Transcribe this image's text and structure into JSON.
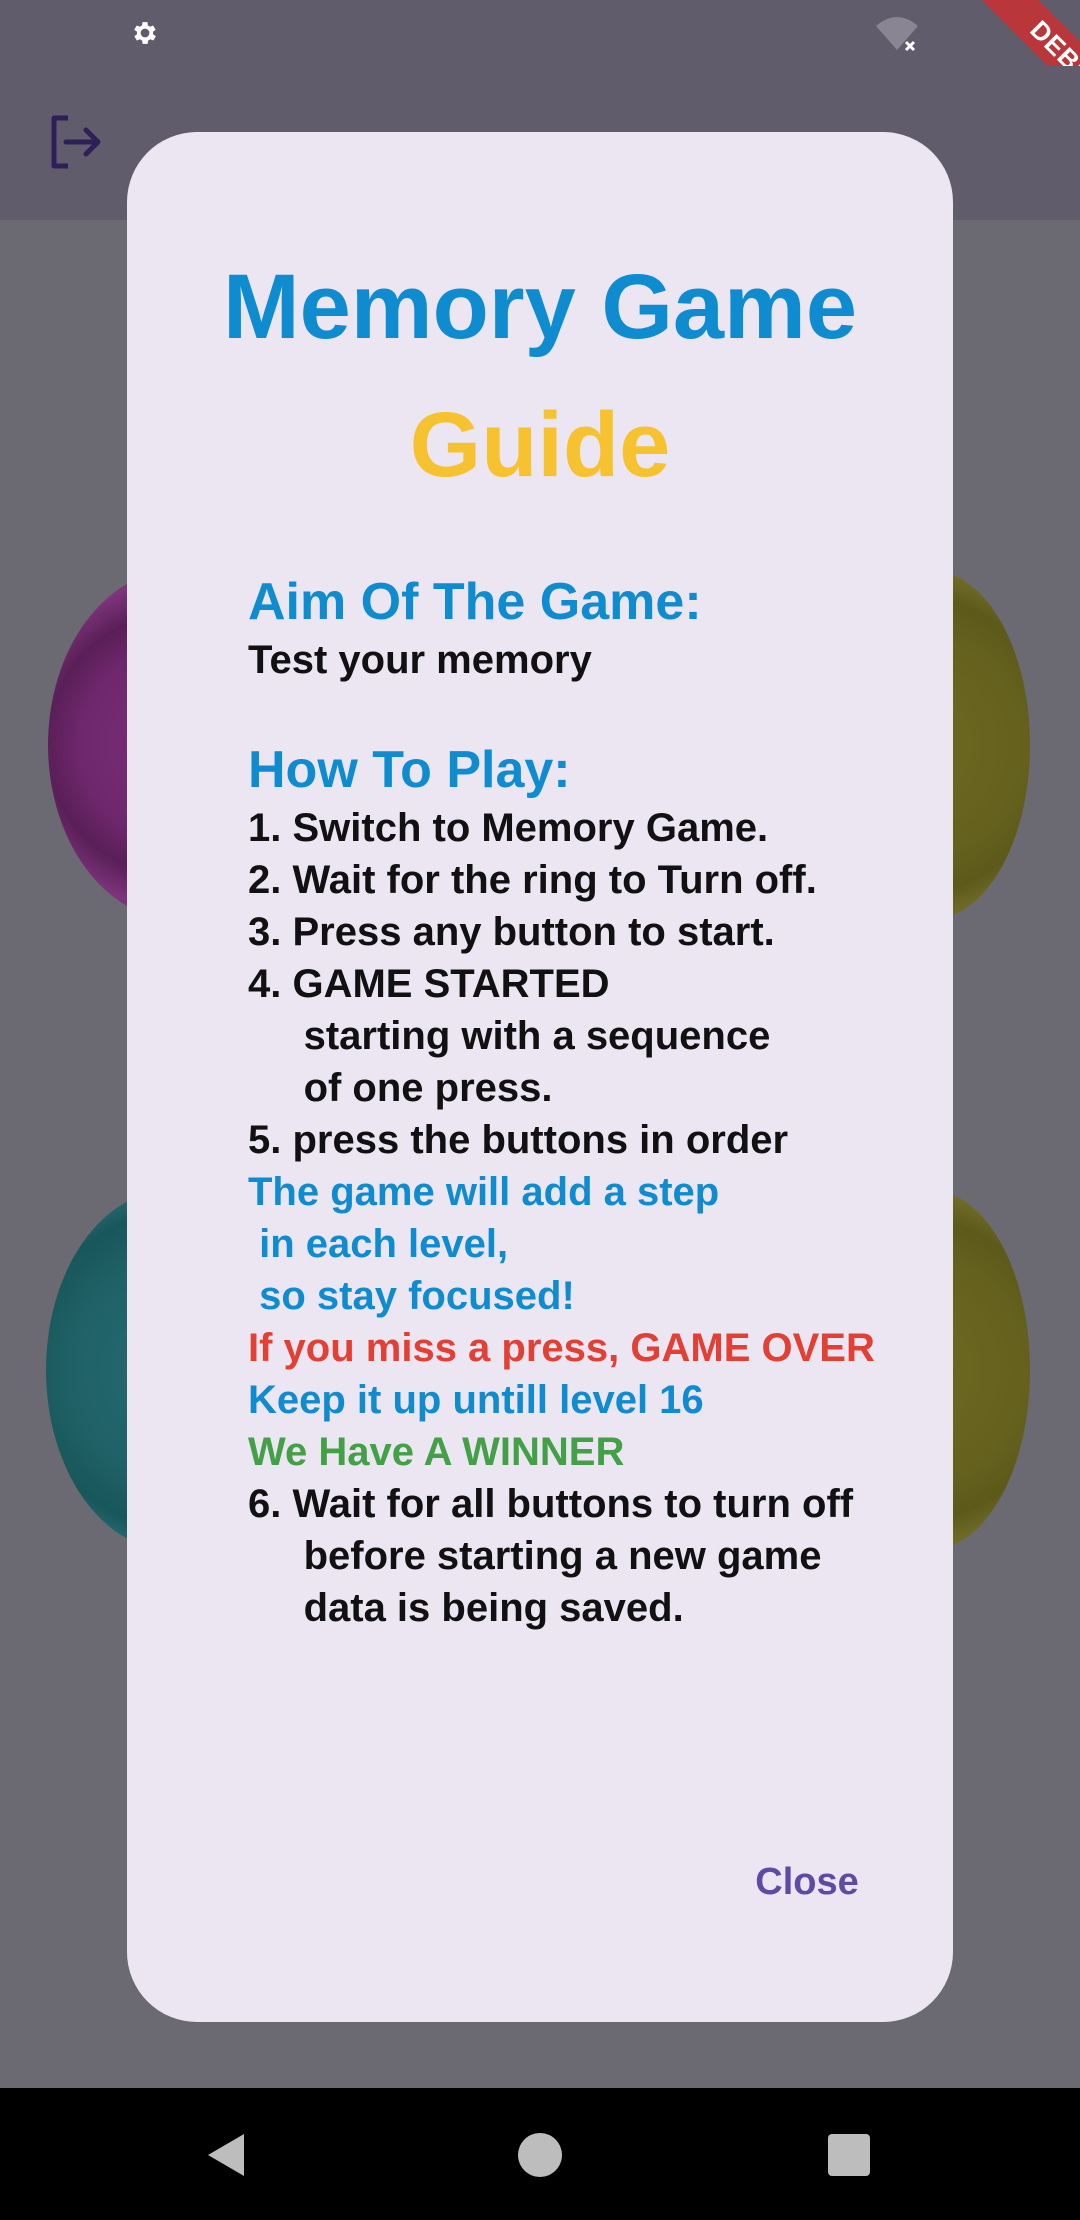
{
  "status_bar": {
    "debug_label": "DEBUG"
  },
  "dialog": {
    "title_line1": "Memory Game",
    "title_line2": "Guide",
    "aim_heading": "Aim Of The Game:",
    "aim_text": "Test your memory",
    "howto_heading": "How To Play:",
    "steps": [
      "1. Switch to Memory Game.",
      "2. Wait for the ring to Turn off.",
      "3. Press any button to start.",
      "4. GAME STARTED",
      "     starting with a sequence",
      "     of one press.",
      "5. press the buttons in order"
    ],
    "blue_lines": [
      "The game will add a step",
      " in each level,",
      " so stay focused!"
    ],
    "game_over_line": "If you miss a press, GAME OVER",
    "keep_up_line": "Keep it up untill level 16",
    "winner_line": "We Have A WINNER",
    "final_steps": [
      "6. Wait for all buttons to turn off",
      "     before starting a new game",
      "     data is being saved."
    ],
    "close_label": "Close"
  },
  "colors": {
    "title_blue": "#0f8bd0",
    "title_yellow": "#f6c22f",
    "game_over_red": "#e24035",
    "winner_green": "#43a047",
    "close_purple": "#5f4ba3"
  }
}
